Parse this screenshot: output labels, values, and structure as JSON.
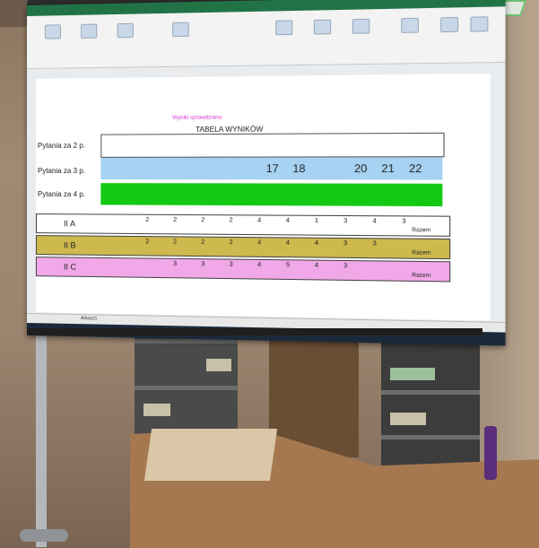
{
  "sheet": {
    "title": "Wyniki sprawdzianu",
    "chart_title": "TABELA WYNIKÓW"
  },
  "rows": [
    {
      "label": "Pytania za 2 p.",
      "color": "#ffffff"
    },
    {
      "label": "Pytania za 3 p.",
      "color": "#a7d2f2"
    },
    {
      "label": "Pytania za 4 p.",
      "color": "#13c913"
    }
  ],
  "row3_numbers": [
    "17",
    "18",
    "20",
    "21",
    "22"
  ],
  "classes": [
    {
      "label": "II A",
      "color": "#ffffff",
      "values": [
        "2",
        "2",
        "2",
        "2",
        "4",
        "4",
        "1",
        "3",
        "4",
        "3"
      ],
      "razem": "Razem"
    },
    {
      "label": "II B",
      "color": "#cdb94e",
      "values": [
        "2",
        "2",
        "2",
        "2",
        "4",
        "4",
        "4",
        "3",
        "3"
      ],
      "razem": "Razem"
    },
    {
      "label": "II C",
      "color": "#f0a8e8",
      "values": [
        "3",
        "3",
        "3",
        "4",
        "5",
        "4",
        "3"
      ],
      "razem": "Razem"
    }
  ],
  "tabs": {
    "sheet1": "Arkusz1"
  },
  "colors": {
    "excel_green": "#217346",
    "taskbar": "#1b2a3a"
  }
}
